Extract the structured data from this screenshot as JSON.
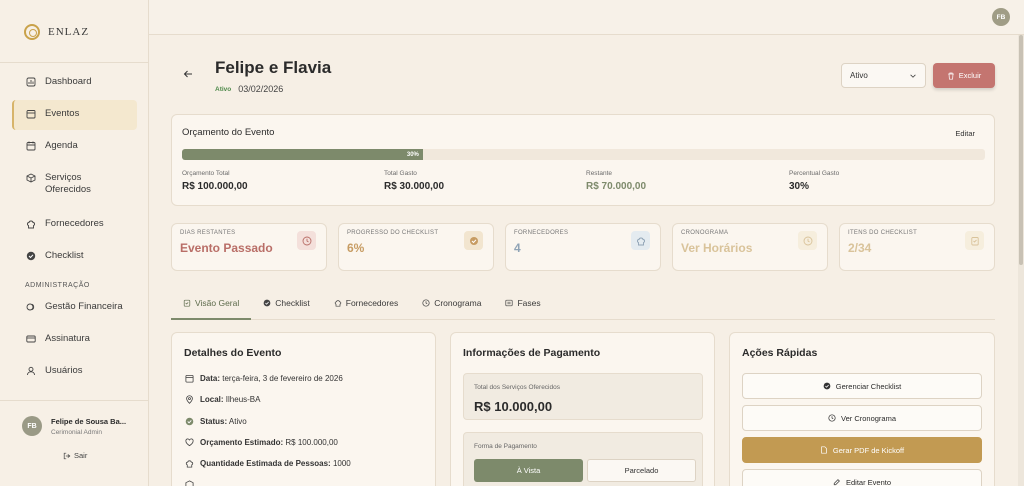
{
  "brand": {
    "name": "ENLAZ"
  },
  "sidebar": {
    "items": [
      {
        "label": "Dashboard"
      },
      {
        "label": "Eventos"
      },
      {
        "label": "Agenda"
      },
      {
        "label": "Serviços Oferecidos"
      },
      {
        "label": "Fornecedores"
      },
      {
        "label": "Checklist"
      }
    ],
    "admin_section": "ADMINISTRAÇÃO",
    "admin_items": [
      {
        "label": "Gestão Financeira"
      },
      {
        "label": "Assinatura"
      },
      {
        "label": "Usuários"
      }
    ],
    "user": {
      "initials": "FB",
      "name": "Felipe de Sousa Ba...",
      "role": "Cerimonial Admin"
    },
    "logout_label": "Sair"
  },
  "topbar": {
    "avatar_initials": "FB"
  },
  "header": {
    "title": "Felipe e Flavia",
    "status": "Ativo",
    "date": "03/02/2026",
    "status_select": "Ativo",
    "delete_label": "Excluir"
  },
  "budget": {
    "title": "Orçamento do Evento",
    "edit_label": "Editar",
    "progress_percent": 30,
    "progress_label": "30%",
    "stats": [
      {
        "label": "Orçamento Total",
        "value": "R$ 100.000,00"
      },
      {
        "label": "Total Gasto",
        "value": "R$ 30.000,00"
      },
      {
        "label": "Restante",
        "value": "R$ 70.000,00"
      },
      {
        "label": "Percentual Gasto",
        "value": "30%"
      }
    ]
  },
  "stat_cards": [
    {
      "label": "DIAS RESTANTES",
      "value": "Evento Passado",
      "color": "#b96e67",
      "icon": "clock-icon"
    },
    {
      "label": "PROGRESSO DO CHECKLIST",
      "value": "6%",
      "color": "#c79c63",
      "icon": "check-circle-icon"
    },
    {
      "label": "FORNECEDORES",
      "value": "4",
      "color": "#8fa3b5",
      "icon": "chef-hat-icon"
    },
    {
      "label": "CRONOGRAMA",
      "value": "Ver Horários",
      "color": "#d9c39a",
      "icon": "clock-icon"
    },
    {
      "label": "ITENS DO CHECKLIST",
      "value": "2/34",
      "color": "#d9c39a",
      "icon": "clipboard-icon"
    }
  ],
  "tabs": [
    {
      "label": "Visão Geral"
    },
    {
      "label": "Checklist"
    },
    {
      "label": "Fornecedores"
    },
    {
      "label": "Cronograma"
    },
    {
      "label": "Fases"
    }
  ],
  "details": {
    "title": "Detalhes do Evento",
    "rows": [
      {
        "key": "Data:",
        "value": "terça-feira, 3 de fevereiro de 2026"
      },
      {
        "key": "Local:",
        "value": "Ilheus-BA"
      },
      {
        "key": "Status:",
        "value": "Ativo"
      },
      {
        "key": "Orçamento Estimado:",
        "value": "R$ 100.000,00"
      },
      {
        "key": "Quantidade Estimada de Pessoas:",
        "value": "1000"
      }
    ]
  },
  "payment": {
    "title": "Informações de Pagamento",
    "total_label": "Total dos Serviços Oferecidos",
    "total_value": "R$ 10.000,00",
    "form_label": "Forma de Pagamento",
    "option_cash": "À Vista",
    "option_installments": "Parcelado"
  },
  "actions": {
    "title": "Ações Rápidas",
    "buttons": [
      {
        "label": "Gerenciar Checklist"
      },
      {
        "label": "Ver Cronograma"
      },
      {
        "label": "Gerar PDF de Kickoff"
      },
      {
        "label": "Editar Evento"
      }
    ]
  }
}
